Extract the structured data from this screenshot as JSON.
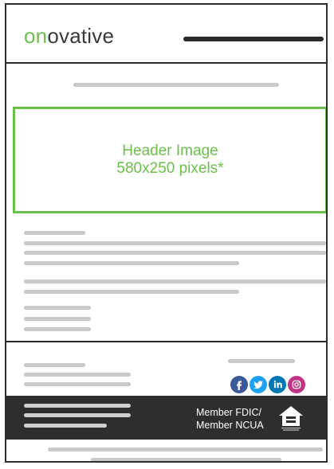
{
  "brand": {
    "logo_prefix": "on",
    "logo_rest": "ovative",
    "accent_color": "#6cc04a",
    "dark_color": "#2e2e2e"
  },
  "hero": {
    "line1": "Header Image",
    "line2": "580x250 pixels*"
  },
  "social": {
    "icons": [
      "facebook-icon",
      "twitter-icon",
      "linkedin-icon",
      "instagram-icon"
    ],
    "colors": {
      "facebook": "#3b5998",
      "twitter": "#1da1f2",
      "linkedin": "#0077b5",
      "instagram": "#c13584"
    }
  },
  "footer": {
    "member_line1": "Member FDIC/",
    "member_line2": "Member NCUA",
    "badge_icon": "equal-housing-lender-icon"
  }
}
